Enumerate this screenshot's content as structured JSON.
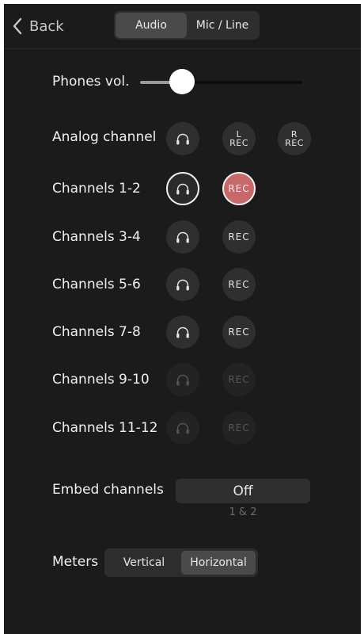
{
  "header": {
    "back_label": "Back",
    "tabs": [
      {
        "label": "Audio",
        "active": true
      },
      {
        "label": "Mic / Line",
        "active": false
      }
    ]
  },
  "phones": {
    "label": "Phones vol.",
    "volume_fraction": 0.26
  },
  "analog": {
    "label": "Analog channel",
    "headphone_icon": "headphones-icon",
    "rec_left": {
      "top": "L",
      "bottom": "REC"
    },
    "rec_right": {
      "top": "R",
      "bottom": "REC"
    }
  },
  "channels": [
    {
      "label": "Channels 1-2",
      "headphones": "selected",
      "rec": "REC",
      "rec_state": "on"
    },
    {
      "label": "Channels 3-4",
      "headphones": "normal",
      "rec": "REC",
      "rec_state": "off"
    },
    {
      "label": "Channels 5-6",
      "headphones": "normal",
      "rec": "REC",
      "rec_state": "off"
    },
    {
      "label": "Channels 7-8",
      "headphones": "normal",
      "rec": "REC",
      "rec_state": "off"
    },
    {
      "label": "Channels 9-10",
      "headphones": "disabled",
      "rec": "REC",
      "rec_state": "disabled"
    },
    {
      "label": "Channels 11-12",
      "headphones": "disabled",
      "rec": "REC",
      "rec_state": "disabled"
    }
  ],
  "embed": {
    "label": "Embed channels",
    "value": "Off",
    "sub": "1 & 2"
  },
  "meters": {
    "label": "Meters",
    "options": [
      {
        "label": "Vertical",
        "active": false
      },
      {
        "label": "Horizontal",
        "active": true
      }
    ]
  },
  "colors": {
    "background": "#1b1b1b",
    "rec_active": "#c7686b",
    "button": "#2f2f2f"
  }
}
